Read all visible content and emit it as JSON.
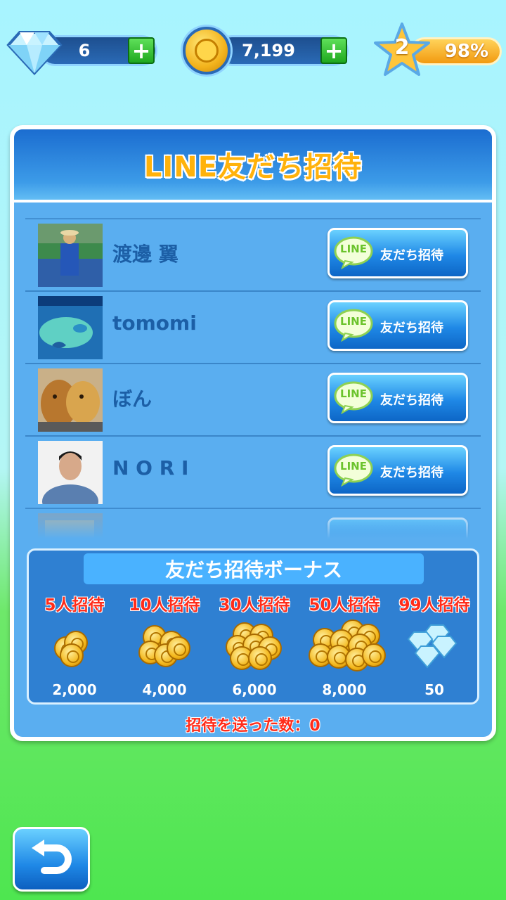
{
  "status_bar": {
    "gems": "6",
    "coins": "7,199",
    "level": "2",
    "level_progress": "98%"
  },
  "panel": {
    "title": "LINE友だち招待"
  },
  "friends": [
    {
      "name": "渡邊 翼",
      "button_badge": "LINE",
      "button_label": "友だち招待"
    },
    {
      "name": "tomomi",
      "button_badge": "LINE",
      "button_label": "友だち招待"
    },
    {
      "name": "ぼん",
      "button_badge": "LINE",
      "button_label": "友だち招待"
    },
    {
      "name": "N O R I",
      "button_badge": "LINE",
      "button_label": "友だち招待"
    }
  ],
  "bonus": {
    "title": "友だち招待ボーナス",
    "tiers": [
      {
        "label": "5人招待",
        "amount": "2,000",
        "icon": "coins-icon"
      },
      {
        "label": "10人招待",
        "amount": "4,000",
        "icon": "coins-icon"
      },
      {
        "label": "30人招待",
        "amount": "6,000",
        "icon": "coins-icon"
      },
      {
        "label": "50人招待",
        "amount": "8,000",
        "icon": "coins-icon"
      },
      {
        "label": "99人招待",
        "amount": "50",
        "icon": "gems-icon"
      }
    ],
    "sent_count": "招待を送った数：0"
  },
  "colors": {
    "panel_blue": "#5aaef0",
    "title_orange": "#ffb20b",
    "tier_red": "#ff2c1a",
    "line_green": "#6bc32c"
  }
}
